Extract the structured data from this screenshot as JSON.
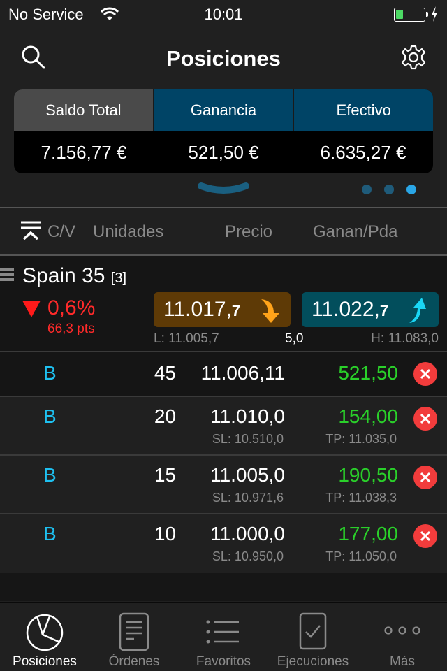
{
  "status_bar": {
    "carrier": "No Service",
    "time": "10:01",
    "battery_level": 0.25
  },
  "nav": {
    "title": "Posiciones"
  },
  "summary": {
    "tabs": [
      {
        "label": "Saldo Total",
        "value": "7.156,77 €",
        "active": true
      },
      {
        "label": "Ganancia",
        "value": "521,50 €",
        "active": false
      },
      {
        "label": "Efectivo",
        "value": "6.635,27 €",
        "active": false
      }
    ],
    "page_count": 3,
    "current_page": 3
  },
  "columns": {
    "side": "C/V",
    "units": "Unidades",
    "price": "Precio",
    "pnl": "Ganan/Pda"
  },
  "instrument": {
    "name": "Spain 35",
    "count": "[3]",
    "change_pct": "0,6%",
    "change_pts": "66,3 pts",
    "direction": "down",
    "sell_price_main": "11.017,",
    "sell_price_small": "7",
    "buy_price_main": "11.022,",
    "buy_price_small": "7",
    "low": "L: 11.005,7",
    "spread": "5,0",
    "high": "H: 11.083,0"
  },
  "total_position": {
    "side": "B",
    "units": "45",
    "price": "11.006,11",
    "pnl": "521,50"
  },
  "positions": [
    {
      "side": "B",
      "units": "20",
      "price": "11.010,0",
      "pnl": "154,00",
      "sl": "SL: 10.510,0",
      "tp": "TP: 11.035,0"
    },
    {
      "side": "B",
      "units": "15",
      "price": "11.005,0",
      "pnl": "190,50",
      "sl": "SL: 10.971,6",
      "tp": "TP: 11.038,3"
    },
    {
      "side": "B",
      "units": "10",
      "price": "11.000,0",
      "pnl": "177,00",
      "sl": "SL: 10.950,0",
      "tp": "TP: 11.050,0"
    }
  ],
  "tab_bar": {
    "items": [
      {
        "label": "Posiciones",
        "icon": "pie-chart-icon",
        "active": true
      },
      {
        "label": "Órdenes",
        "icon": "document-icon",
        "active": false
      },
      {
        "label": "Favoritos",
        "icon": "list-icon",
        "active": false
      },
      {
        "label": "Ejecuciones",
        "icon": "checkbox-icon",
        "active": false
      },
      {
        "label": "Más",
        "icon": "more-icon",
        "active": false
      }
    ]
  },
  "colors": {
    "accent_blue": "#2aa6e6",
    "positive": "#2ad02a",
    "negative": "#ff2a2a",
    "buy_side": "#1ec0f0",
    "sell_box": "#5e3a06",
    "buy_box": "#024e5c"
  }
}
